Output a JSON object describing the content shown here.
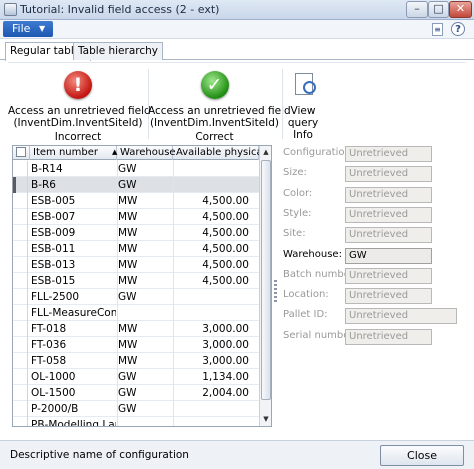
{
  "window": {
    "title": "Tutorial: Invalid field access (2 - ext)"
  },
  "menu": {
    "file_label": "File"
  },
  "tabs": [
    {
      "label": "Regular tables",
      "active": true
    },
    {
      "label": "Table hierarchy",
      "active": false
    }
  ],
  "ribbon": {
    "incorrect": {
      "line1": "Access an unretrieved field",
      "line2": "(InventDim.InventSiteId)",
      "group": "Incorrect"
    },
    "correct": {
      "line1": "Access an unretrieved field",
      "line2": "(InventDim.InventSiteId)",
      "group": "Correct"
    },
    "info": {
      "line1": "View",
      "line2": "query",
      "group": "Info"
    }
  },
  "grid": {
    "columns": [
      "Item number",
      "Warehouse",
      "Available physical"
    ],
    "rows": [
      {
        "item": "B-R14",
        "warehouse": "GW",
        "available": ""
      },
      {
        "item": "B-R6",
        "warehouse": "GW",
        "available": "",
        "selected": true
      },
      {
        "item": "ESB-005",
        "warehouse": "MW",
        "available": "4,500.00"
      },
      {
        "item": "ESB-007",
        "warehouse": "MW",
        "available": "4,500.00"
      },
      {
        "item": "ESB-009",
        "warehouse": "MW",
        "available": "4,500.00"
      },
      {
        "item": "ESB-011",
        "warehouse": "MW",
        "available": "4,500.00"
      },
      {
        "item": "ESB-013",
        "warehouse": "MW",
        "available": "4,500.00"
      },
      {
        "item": "ESB-015",
        "warehouse": "MW",
        "available": "4,500.00"
      },
      {
        "item": "FLL-2500",
        "warehouse": "GW",
        "available": ""
      },
      {
        "item": "FLL-MeasureConfig",
        "warehouse": "",
        "available": ""
      },
      {
        "item": "FT-018",
        "warehouse": "MW",
        "available": "3,000.00"
      },
      {
        "item": "FT-036",
        "warehouse": "MW",
        "available": "3,000.00"
      },
      {
        "item": "FT-058",
        "warehouse": "MW",
        "available": "3,000.00"
      },
      {
        "item": "OL-1000",
        "warehouse": "GW",
        "available": "1,134.00"
      },
      {
        "item": "OL-1500",
        "warehouse": "GW",
        "available": "2,004.00"
      },
      {
        "item": "P-2000/B",
        "warehouse": "GW",
        "available": ""
      },
      {
        "item": "PB-Modelling Lamp",
        "warehouse": "",
        "available": ""
      }
    ]
  },
  "details": [
    {
      "label": "Configuration:",
      "value": "Unretrieved",
      "enabled": false,
      "wide": false
    },
    {
      "label": "Size:",
      "value": "Unretrieved",
      "enabled": false,
      "wide": false
    },
    {
      "label": "Color:",
      "value": "Unretrieved",
      "enabled": false,
      "wide": false
    },
    {
      "label": "Style:",
      "value": "Unretrieved",
      "enabled": false,
      "wide": false
    },
    {
      "label": "Site:",
      "value": "Unretrieved",
      "enabled": false,
      "wide": false
    },
    {
      "label": "Warehouse:",
      "value": "GW",
      "enabled": true,
      "wide": false
    },
    {
      "label": "Batch number:",
      "value": "Unretrieved",
      "enabled": false,
      "wide": false
    },
    {
      "label": "Location:",
      "value": "Unretrieved",
      "enabled": false,
      "wide": false
    },
    {
      "label": "Pallet ID:",
      "value": "Unretrieved",
      "enabled": false,
      "wide": true
    },
    {
      "label": "Serial number:",
      "value": "Unretrieved",
      "enabled": false,
      "wide": false
    }
  ],
  "status": {
    "text": "Descriptive name of configuration",
    "close_label": "Close"
  }
}
